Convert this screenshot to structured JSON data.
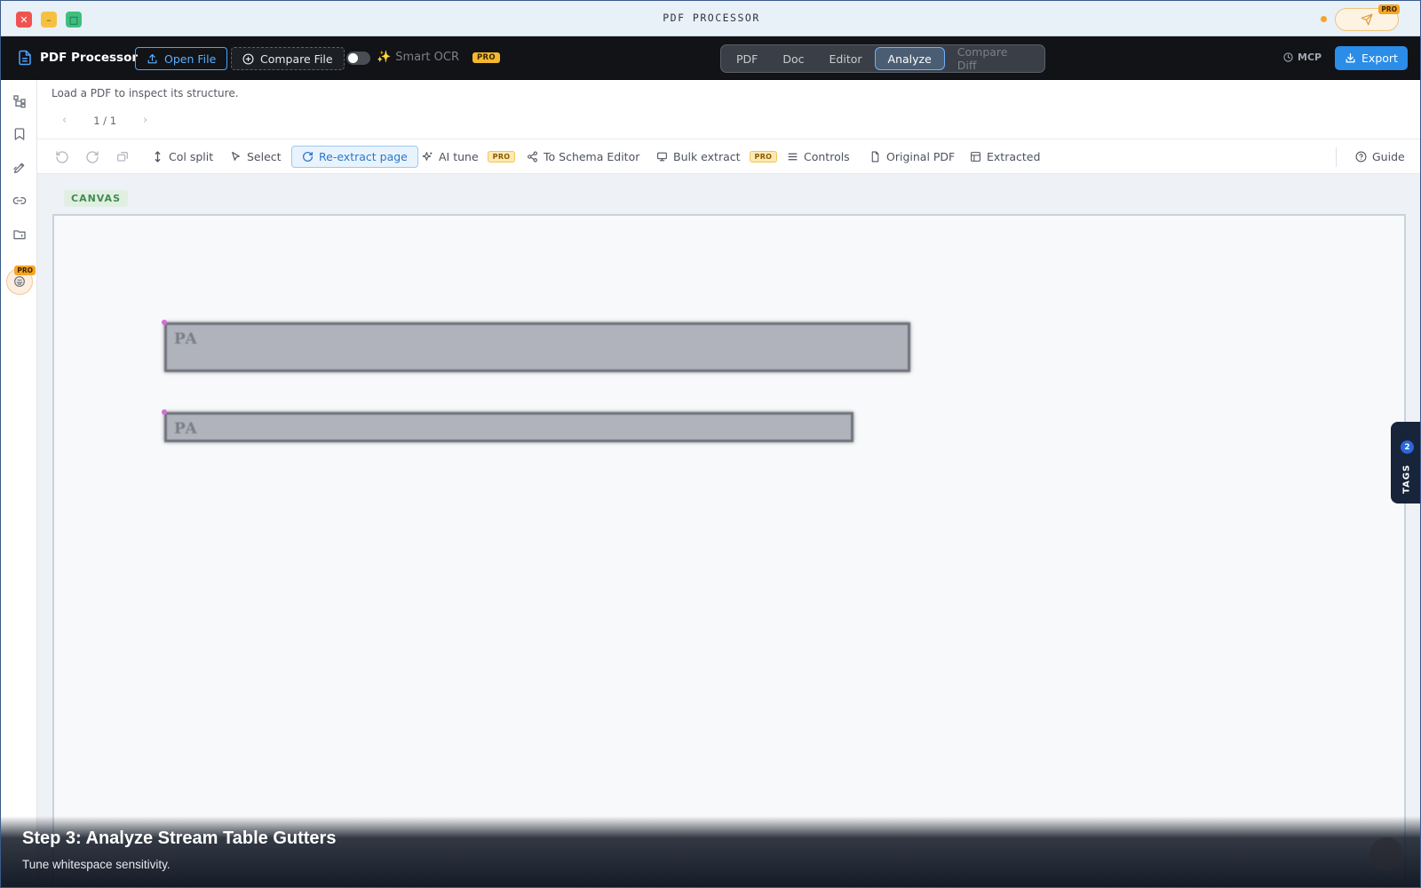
{
  "window": {
    "title": "PDF PROCESSOR",
    "close_glyph": "✕",
    "min_glyph": "–",
    "max_glyph": "□"
  },
  "topright": {
    "send_pro": "PRO"
  },
  "toolbar": {
    "app_name": "PDF Processor",
    "open_file": "Open File",
    "compare_file": "Compare File",
    "smart_ocr": "Smart OCR",
    "smart_ocr_icon": "✨",
    "pro": "PRO",
    "tabs": [
      {
        "label": "PDF"
      },
      {
        "label": "Doc"
      },
      {
        "label": "Editor"
      },
      {
        "label": "Analyze"
      },
      {
        "label": "Compare Diff"
      }
    ],
    "active_tab": "Analyze",
    "mcp": "MCP",
    "export": "Export"
  },
  "rail": {
    "pro": "PRO"
  },
  "info": {
    "message": "Load a PDF to inspect its structure.",
    "page_indicator": "1 / 1"
  },
  "analysis_toolbar": {
    "col_split": "Col split",
    "select": "Select",
    "re_extract": "Re-extract page",
    "ai_tune": "AI tune",
    "to_schema": "To Schema Editor",
    "bulk_extract": "Bulk extract",
    "controls": "Controls",
    "original_pdf": "Original PDF",
    "extracted": "Extracted",
    "guide": "Guide",
    "pro": "PRO"
  },
  "canvas": {
    "label": "CANVAS",
    "regions": [
      {
        "text": "PA"
      },
      {
        "text": "PA"
      }
    ]
  },
  "tags": {
    "count": "2",
    "label": "TAGS"
  },
  "step": {
    "title": "Step 3: Analyze Stream Table Gutters",
    "subtitle": "Tune whitespace sensitivity."
  },
  "colors": {
    "accent": "#2b8de8",
    "pro_badge": "#f5b82e",
    "toolbar_bg": "#111317",
    "canvas_label": "#3f8d4f"
  },
  "icons": {
    "rail": [
      "hierarchy-icon",
      "bookmark-icon",
      "edit-pen-icon",
      "link-icon",
      "folder-icon",
      "ai-brain-icon"
    ],
    "toolbar": [
      "undo-icon",
      "redo-icon",
      "reset-icon"
    ]
  }
}
